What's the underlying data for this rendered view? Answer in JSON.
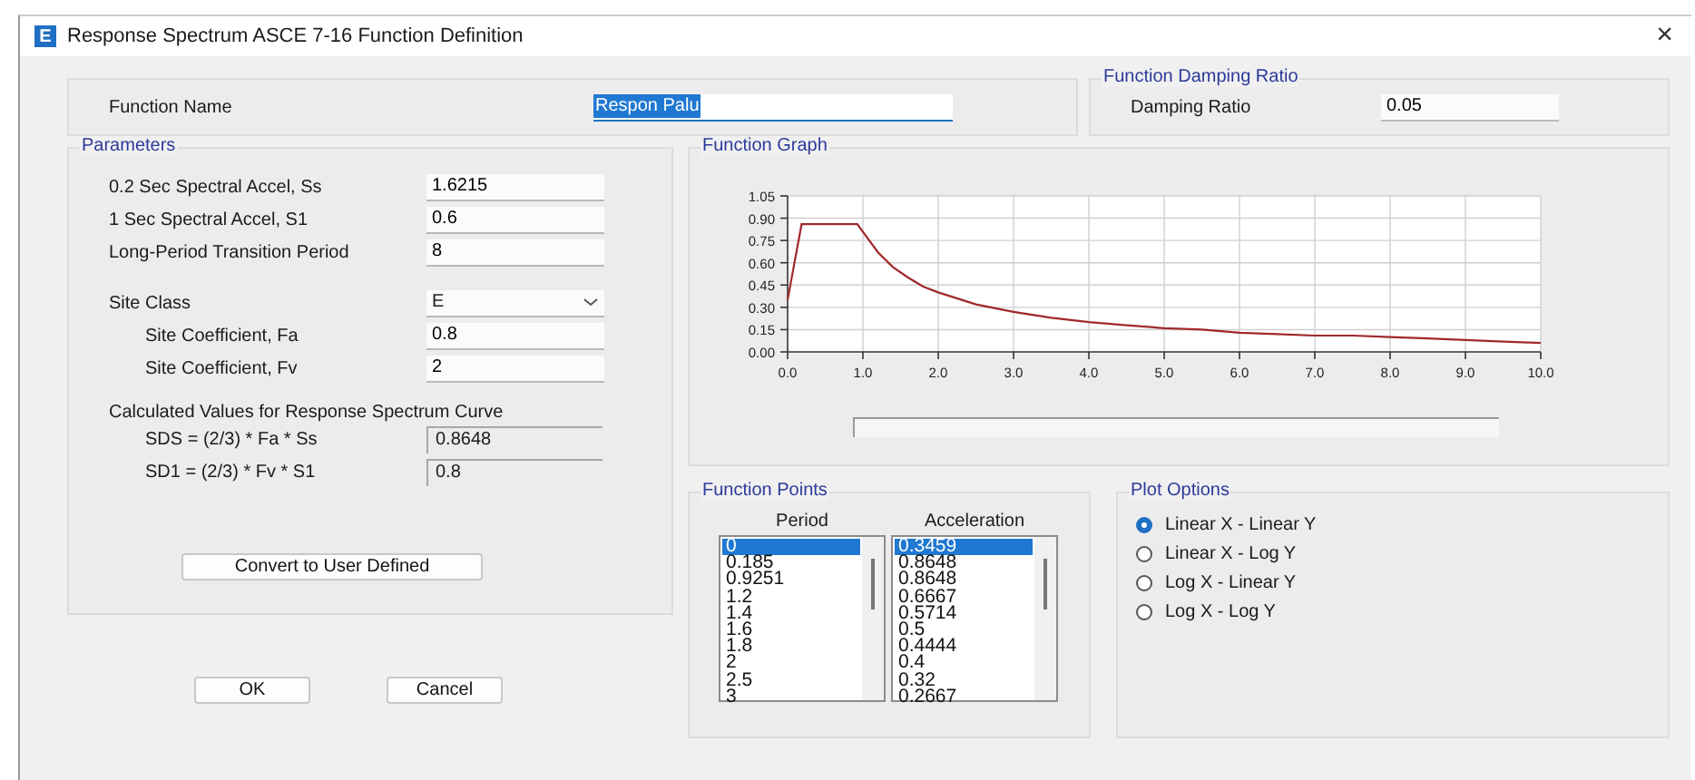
{
  "window": {
    "icon_letter": "E",
    "title": "Response Spectrum ASCE 7-16 Function Definition",
    "close": "×"
  },
  "function_name": {
    "label": "Function Name",
    "value": "Respon Palu"
  },
  "damping": {
    "group": "Function Damping Ratio",
    "label": "Damping Ratio",
    "value": "0.05"
  },
  "parameters": {
    "group": "Parameters",
    "fields": [
      {
        "kind": "input",
        "label": "0.2 Sec Spectral Accel, Ss",
        "value": "1.6215",
        "indented": false
      },
      {
        "kind": "input",
        "label": "1 Sec Spectral Accel, S1",
        "value": "0.6",
        "indented": false
      },
      {
        "kind": "input",
        "label": "Long-Period Transition Period",
        "value": "8",
        "indented": false
      },
      {
        "kind": "select",
        "label": "Site Class",
        "value": "E",
        "indented": false
      },
      {
        "kind": "input",
        "label": "Site Coefficient, Fa",
        "value": "0.8",
        "indented": true
      },
      {
        "kind": "input",
        "label": "Site Coefficient, Fv",
        "value": "2",
        "indented": true
      }
    ],
    "calc_title": "Calculated Values for Response Spectrum Curve",
    "calculated": [
      {
        "label": "SDS = (2/3) * Fa * Ss",
        "value": "0.8648"
      },
      {
        "label": "SD1 = (2/3) * Fv * S1",
        "value": "0.8"
      }
    ],
    "convert_button": "Convert to User Defined"
  },
  "buttons": [
    "OK",
    "Cancel"
  ],
  "graph": {
    "group": "Function Graph",
    "chart_data": {
      "type": "line",
      "x": [
        0,
        0.185,
        0.9251,
        1.2,
        1.4,
        1.6,
        1.8,
        2,
        2.5,
        3,
        3.5,
        4,
        4.5,
        5,
        5.5,
        6,
        6.5,
        7,
        7.5,
        8,
        8.5,
        9,
        9.5,
        10
      ],
      "series": [
        {
          "color": "#a0282c",
          "values": [
            0.35,
            0.86,
            0.86,
            0.67,
            0.57,
            0.5,
            0.44,
            0.4,
            0.32,
            0.27,
            0.23,
            0.2,
            0.18,
            0.16,
            0.15,
            0.13,
            0.12,
            0.11,
            0.11,
            0.1,
            0.09,
            0.08,
            0.07,
            0.06
          ]
        }
      ],
      "xlim": [
        0,
        10
      ],
      "ylim": [
        0,
        1.05
      ],
      "grid": true,
      "xticks": [
        {
          "value": 0,
          "label": "0.0"
        },
        {
          "value": 1,
          "label": "1.0"
        },
        {
          "value": 2,
          "label": "2.0"
        },
        {
          "value": 3,
          "label": "3.0"
        },
        {
          "value": 4,
          "label": "4.0"
        },
        {
          "value": 5,
          "label": "5.0"
        },
        {
          "value": 6,
          "label": "6.0"
        },
        {
          "value": 7,
          "label": "7.0"
        },
        {
          "value": 8,
          "label": "8.0"
        },
        {
          "value": 9,
          "label": "9.0"
        },
        {
          "value": 10,
          "label": "10.0"
        }
      ],
      "yticks": [
        {
          "value": 0,
          "label": "0.00"
        },
        {
          "value": 0.15,
          "label": "0.15"
        },
        {
          "value": 0.3,
          "label": "0.30"
        },
        {
          "value": 0.45,
          "label": "0.45"
        },
        {
          "value": 0.6,
          "label": "0.60"
        },
        {
          "value": 0.75,
          "label": "0.75"
        },
        {
          "value": 0.9,
          "label": "0.90"
        },
        {
          "value": 1.05,
          "label": "1.05"
        }
      ]
    }
  },
  "function_points": {
    "group": "Function Points",
    "columns": [
      {
        "header": "Period",
        "items": [
          {
            "text": "0",
            "selected": true
          },
          {
            "text": "0.185",
            "selected": false
          },
          {
            "text": "0.9251",
            "selected": false
          },
          {
            "text": "1.2",
            "selected": false
          },
          {
            "text": "1.4",
            "selected": false
          },
          {
            "text": "1.6",
            "selected": false
          },
          {
            "text": "1.8",
            "selected": false
          },
          {
            "text": "2",
            "selected": false
          },
          {
            "text": "2.5",
            "selected": false
          },
          {
            "text": "3",
            "selected": false
          }
        ]
      },
      {
        "header": "Acceleration",
        "items": [
          {
            "text": "0.3459",
            "selected": true
          },
          {
            "text": "0.8648",
            "selected": false
          },
          {
            "text": "0.8648",
            "selected": false
          },
          {
            "text": "0.6667",
            "selected": false
          },
          {
            "text": "0.5714",
            "selected": false
          },
          {
            "text": "0.5",
            "selected": false
          },
          {
            "text": "0.4444",
            "selected": false
          },
          {
            "text": "0.4",
            "selected": false
          },
          {
            "text": "0.32",
            "selected": false
          },
          {
            "text": "0.2667",
            "selected": false
          }
        ]
      }
    ]
  },
  "plot_options": {
    "group": "Plot Options",
    "options": [
      {
        "label": "Linear X - Linear Y",
        "selected": true
      },
      {
        "label": "Linear X - Log Y",
        "selected": false
      },
      {
        "label": "Log X - Linear Y",
        "selected": false
      },
      {
        "label": "Log X - Log Y",
        "selected": false
      }
    ]
  }
}
